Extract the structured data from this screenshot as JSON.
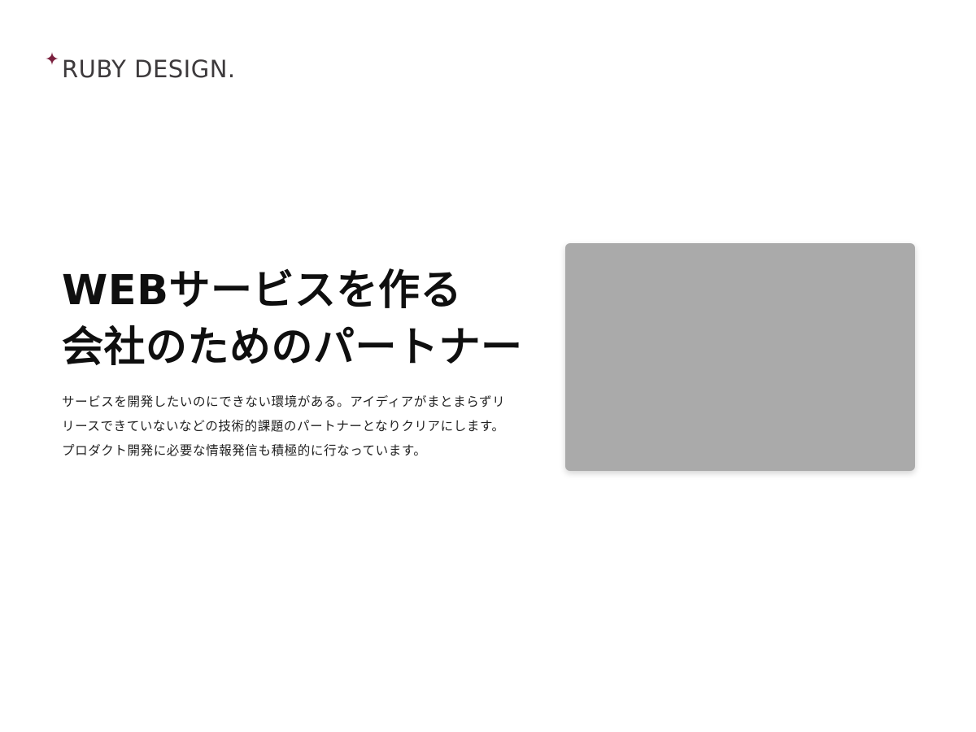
{
  "brand": {
    "name": "RUBY DESIGN.",
    "icon": "sparkle-star-icon",
    "accent_color": "#7a1f3d"
  },
  "hero": {
    "headline_lines": [
      "WEBサービスを作る",
      "会社のためのパートナー"
    ],
    "description_lines": [
      "サービスを開発したいのにできない環境がある。アイディアがまとまらずリ",
      "リースできていないなどの技術的課題のパートナーとなりクリアにします。",
      "プロダクト開発に必要な情報発信も積極的に行なっています。"
    ],
    "image_placeholder_color": "#aaaaaa"
  }
}
